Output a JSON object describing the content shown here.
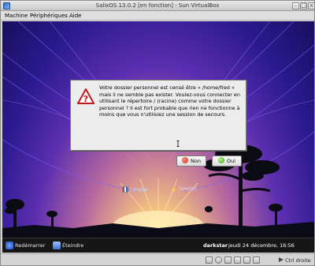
{
  "window": {
    "title": "SalixOS 13.0.2 [en fonction] - Sun VirtualBox"
  },
  "menubar": {
    "items": [
      {
        "label": "Machine"
      },
      {
        "label": "Périphériques"
      },
      {
        "label": "Aide"
      }
    ]
  },
  "login": {
    "language_label": "Langue",
    "session_label": "Session"
  },
  "dialog": {
    "icon": "question-icon",
    "message": "Votre dossier personnel est censé être « /home/fred » mais il ne semble pas exister. Voulez-vous connecter en utilisant le répertoire / (racine) comme votre dossier personnel ? Il est fort probable que rien ne fonctionne à moins que vous n'utilisiez une session de secours.",
    "no_label": "Non",
    "yes_label": "Oui",
    "no_color": "#d62d20",
    "yes_color": "#3fa535"
  },
  "taskbar": {
    "restart_label": "Redémarrer",
    "shutdown_label": "Éteindre",
    "hostname": "darkstar",
    "clock": "jeudi 24 décembre, 16:56"
  },
  "statusbar": {
    "host_key_label": "Ctrl droite",
    "icons": [
      "hdd-icon",
      "cd-icon",
      "usb-icon",
      "network-icon",
      "shared-folder-icon",
      "mouse-icon"
    ]
  }
}
